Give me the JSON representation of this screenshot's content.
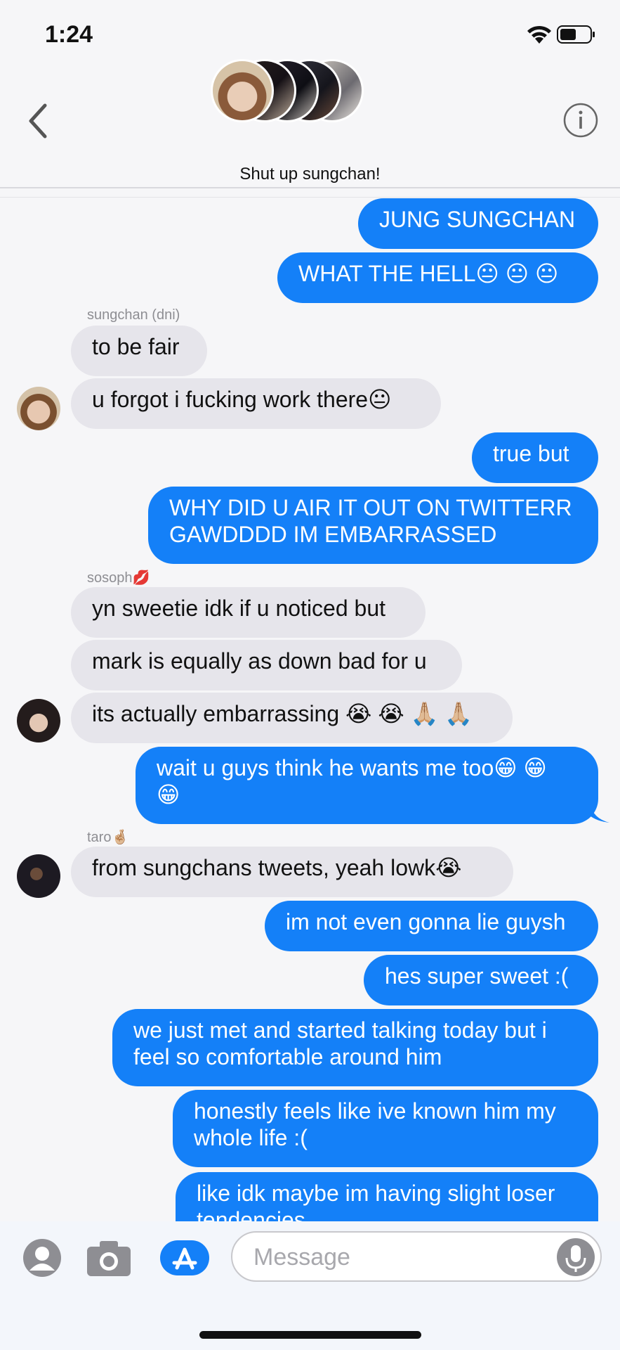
{
  "status_bar": {
    "time": "1:24"
  },
  "header": {
    "group_name": "Shut up sungchan!"
  },
  "messages": [
    {
      "type": "out",
      "text": "JUNG SUNGCHAN"
    },
    {
      "type": "out",
      "text": "WHAT THE HELL😐 😐 😐"
    },
    {
      "type": "sender",
      "text": "sungchan (dni)"
    },
    {
      "type": "in",
      "text": "to be fair"
    },
    {
      "type": "in",
      "text": "u forgot i fucking work there😐"
    },
    {
      "type": "out",
      "text": "true but"
    },
    {
      "type": "out",
      "text": "WHY DID U AIR IT OUT ON TWITTERR\nGAWDDDD IM EMBARRASSED"
    },
    {
      "type": "sender",
      "text": "sosoph💋"
    },
    {
      "type": "in",
      "text": "yn sweetie idk if u noticed but"
    },
    {
      "type": "in",
      "text": "mark is equally as down bad for u"
    },
    {
      "type": "in",
      "text": "its actually embarrassing 😭 😭 🙏🏼 🙏🏼"
    },
    {
      "type": "out",
      "text": "wait u guys think he wants me too😁 😁\n😁"
    },
    {
      "type": "sender",
      "text": "taro🤞🏼"
    },
    {
      "type": "in",
      "text": "from sungchans tweets, yeah lowk😭"
    },
    {
      "type": "out",
      "text": "im not even gonna lie guysh"
    },
    {
      "type": "out",
      "text": "hes super sweet :("
    },
    {
      "type": "out",
      "text": "we just met and started talking today but i\nfeel so comfortable around him"
    },
    {
      "type": "out",
      "text": "honestly feels like ive known him my\nwhole life :("
    },
    {
      "type": "out",
      "text": "like idk maybe im having slight loser\ntendencies"
    }
  ],
  "compose": {
    "placeholder": "Message"
  },
  "colors": {
    "outgoing": "#1480f8",
    "incoming": "#e6e5eb",
    "background": "#f6f6f8"
  },
  "icons": [
    "back-chevron-icon",
    "info-icon",
    "contact-icon",
    "camera-icon",
    "app-store-icon",
    "microphone-icon",
    "wifi-icon",
    "battery-icon"
  ]
}
